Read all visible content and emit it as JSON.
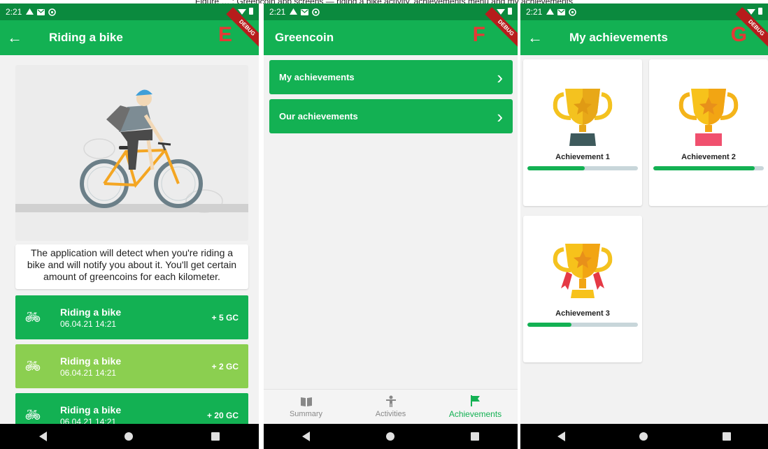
{
  "caption": "Figure … : Greencoin app screens — riding a bike activity, achievements menu and my achievements",
  "status": {
    "time": "2:21"
  },
  "debug_label": "DEBUG",
  "phone_e": {
    "letter": "E",
    "title": "Riding a bike",
    "description": "The application will detect when you're riding a bike and will notify you about it. You'll get certain amount of greencoins for each kilometer.",
    "activities": [
      {
        "name": "Riding a bike",
        "time": "06.04.21 14:21",
        "coins": "+ 5 GC",
        "color": "#13b153"
      },
      {
        "name": "Riding a bike",
        "time": "06.04.21 14:21",
        "coins": "+ 2 GC",
        "color": "#8bcf50"
      },
      {
        "name": "Riding a bike",
        "time": "06.04.21 14:21",
        "coins": "+ 20 GC",
        "color": "#13b153"
      }
    ]
  },
  "phone_f": {
    "letter": "F",
    "title": "Greencoin",
    "menu": [
      {
        "label": "My achievements"
      },
      {
        "label": "Our achievements"
      }
    ],
    "bottom_nav": [
      {
        "label": "Summary",
        "icon": "book-icon"
      },
      {
        "label": "Activities",
        "icon": "person-icon"
      },
      {
        "label": "Achievements",
        "icon": "flag-icon",
        "active": true
      }
    ]
  },
  "phone_g": {
    "letter": "G",
    "title": "My achievements",
    "achievements": [
      {
        "name": "Achievement 1",
        "progress": 0.52
      },
      {
        "name": "Achievement 2",
        "progress": 0.92
      },
      {
        "name": "Achievement 3",
        "progress": 0.4
      }
    ]
  },
  "colors": {
    "primary": "#13b153",
    "status": "#0b8a3e",
    "light_green": "#8bcf50",
    "letter": "#e53935"
  }
}
